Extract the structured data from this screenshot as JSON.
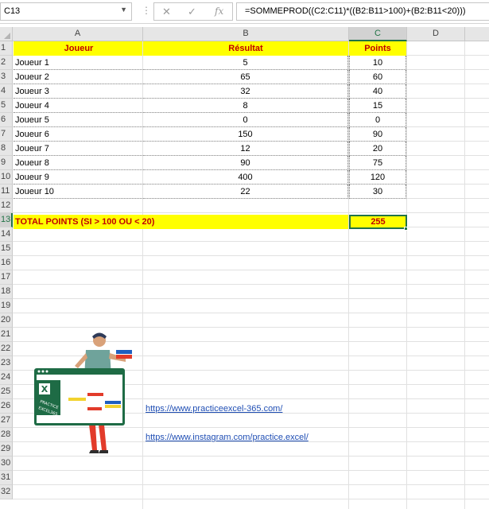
{
  "formula_bar": {
    "name_box": "C13",
    "cancel_glyph": "✕",
    "confirm_glyph": "✓",
    "fx_glyph": "fx",
    "formula": "=SOMMEPROD((C2:C11)*((B2:B11>100)+(B2:B11<20)))"
  },
  "columns": [
    "A",
    "B",
    "C",
    "D"
  ],
  "selected_column": "C",
  "selected_row": "13",
  "rows": [
    "1",
    "2",
    "3",
    "4",
    "5",
    "6",
    "7",
    "8",
    "9",
    "10",
    "11",
    "12",
    "13",
    "14",
    "15",
    "16",
    "17",
    "18",
    "19",
    "20",
    "21",
    "22",
    "23",
    "24",
    "25",
    "26",
    "27",
    "28",
    "29",
    "30",
    "31",
    "32"
  ],
  "table": {
    "headers": [
      "Joueur",
      "Résultat",
      "Points"
    ],
    "data": [
      [
        "Joueur 1",
        "5",
        "10"
      ],
      [
        "Joueur 2",
        "65",
        "60"
      ],
      [
        "Joueur 3",
        "32",
        "40"
      ],
      [
        "Joueur 4",
        "8",
        "15"
      ],
      [
        "Joueur 5",
        "0",
        "0"
      ],
      [
        "Joueur 6",
        "150",
        "90"
      ],
      [
        "Joueur 7",
        "12",
        "20"
      ],
      [
        "Joueur 8",
        "90",
        "75"
      ],
      [
        "Joueur 9",
        "400",
        "120"
      ],
      [
        "Joueur 10",
        "22",
        "30"
      ]
    ]
  },
  "total": {
    "label": "TOTAL  POINTS (SI > 100 OU < 20)",
    "value": "255"
  },
  "links": {
    "website": "https://www.practiceexcel-365.com/",
    "instagram": "https://www.instagram.com/practice.excel/"
  },
  "logo_text": "PRACTICE EXCEL365",
  "colors": {
    "highlight": "#ffff00",
    "header_text": "#c00000",
    "selection": "#217346",
    "link": "#1f4eb4"
  }
}
